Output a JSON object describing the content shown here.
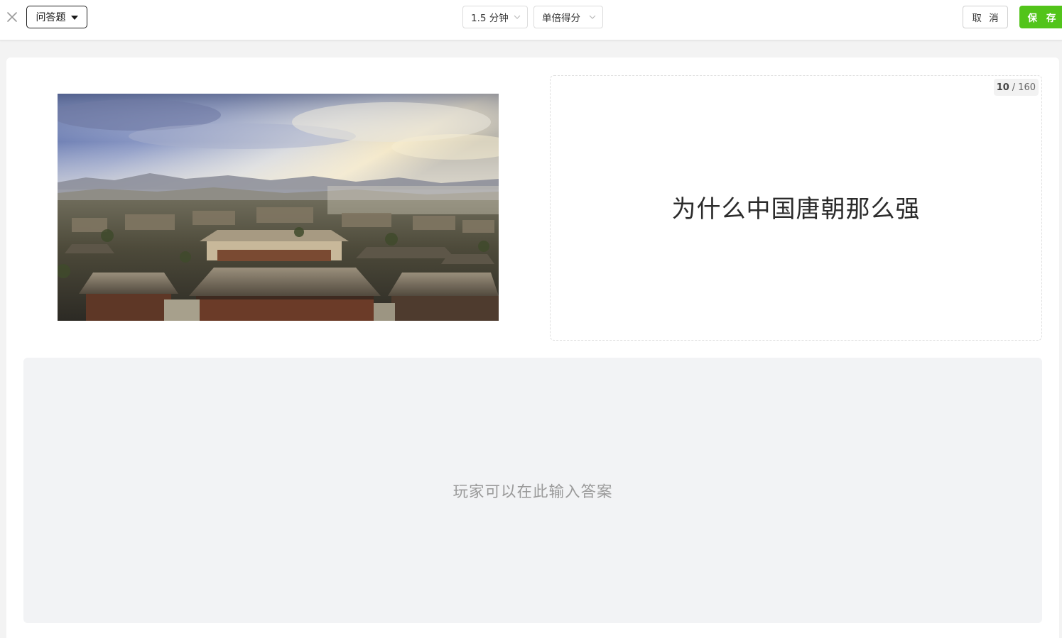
{
  "topbar": {
    "question_type": "问答题",
    "time_limit": "1.5 分钟",
    "score_mode": "单倍得分",
    "cancel_label": "取 消",
    "save_label": "保 存",
    "accent_color": "#52c41a"
  },
  "question": {
    "text": "为什么中国唐朝那么强",
    "char_count": "10",
    "char_separator": "/",
    "char_limit": "160"
  },
  "answer": {
    "placeholder": "玩家可以在此输入答案"
  },
  "icons": {
    "close": "close-icon",
    "type_caret": "caret-down-icon",
    "dropdown_chevron": "chevron-down-icon"
  }
}
